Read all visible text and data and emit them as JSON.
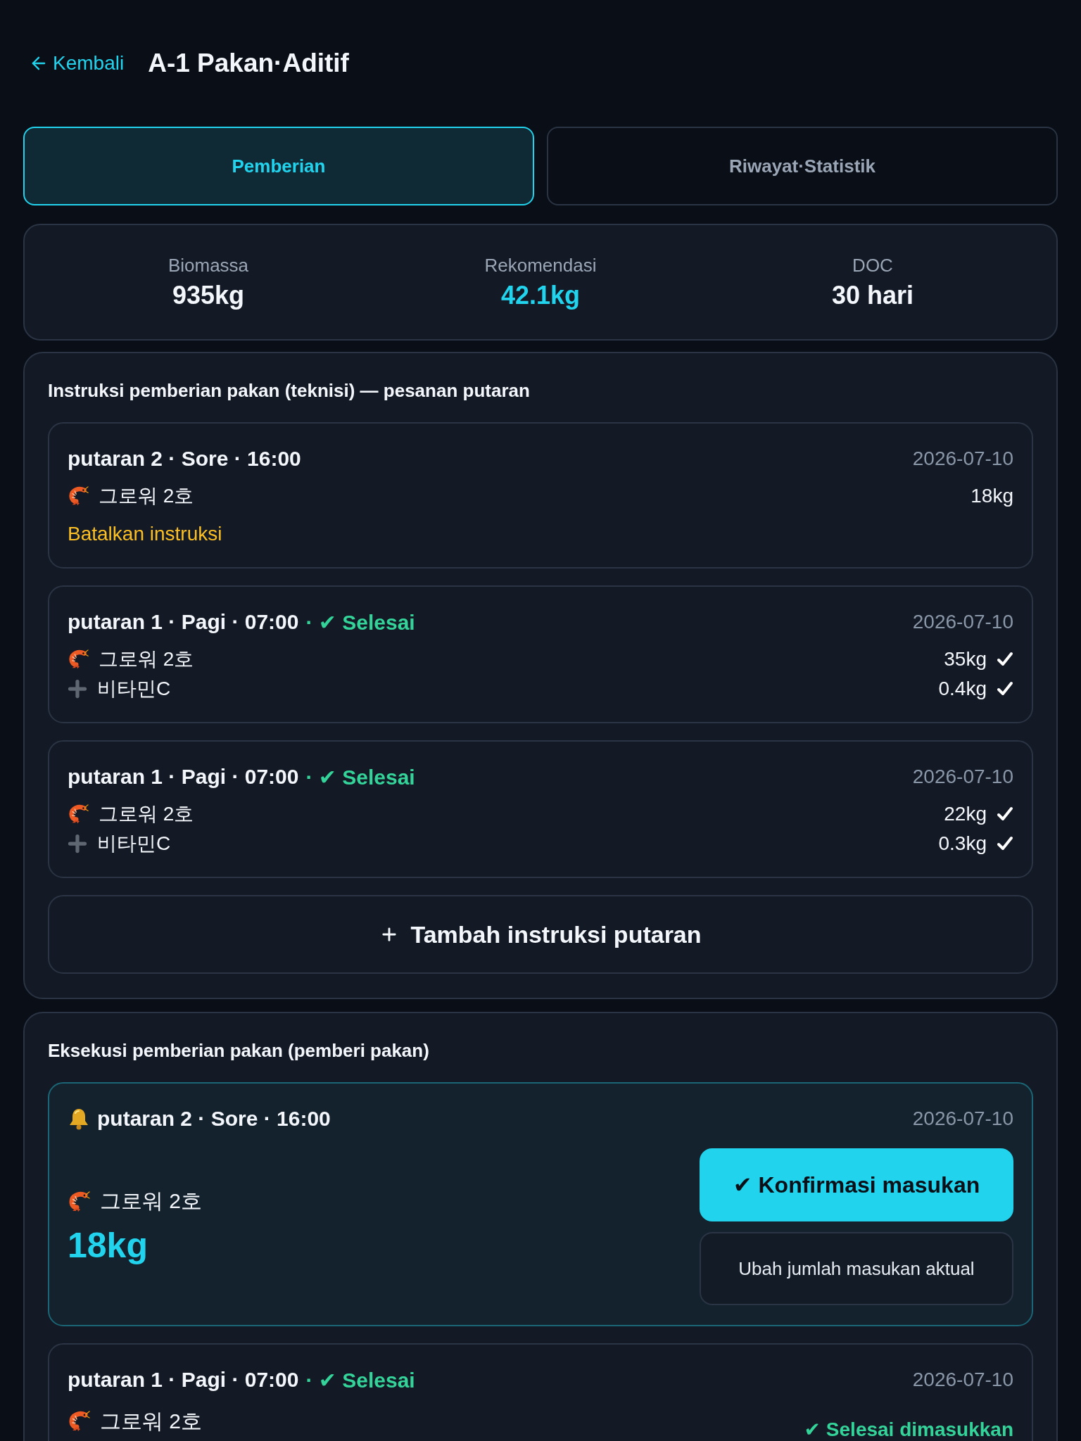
{
  "header": {
    "back_label": "Kembali",
    "title": "A-1 Pakan·Aditif"
  },
  "tabs": [
    {
      "label": "Pemberian",
      "selected": true
    },
    {
      "label": "Riwayat·Statistik",
      "selected": false
    }
  ],
  "stats": [
    {
      "label": "Biomassa",
      "value": "935kg",
      "highlight": false
    },
    {
      "label": "Rekomendasi",
      "value": "42.1kg",
      "highlight": true
    },
    {
      "label": "DOC",
      "value": "30 hari",
      "highlight": false
    }
  ],
  "instructions": {
    "title": "Instruksi pemberian pakan (teknisi) — pesanan putaran",
    "rounds": [
      {
        "title": "putaran 2 · Sore · 16:00",
        "date": "2026-07-10",
        "items": [
          {
            "kind": "feed",
            "name": "그로워 2호",
            "amount": "18kg",
            "confirmed": false
          }
        ],
        "cancel_link": "Batalkan instruksi"
      },
      {
        "title": "putaran 1 · Pagi · 07:00",
        "status": "· ✔ Selesai",
        "date": "2026-07-10",
        "items": [
          {
            "kind": "feed",
            "name": "그로워 2호",
            "amount": "35kg",
            "confirmed": true
          },
          {
            "kind": "additive",
            "name": "비타민C",
            "amount": "0.4kg",
            "confirmed": true
          }
        ]
      },
      {
        "title": "putaran 1 · Pagi · 07:00",
        "status": "· ✔ Selesai",
        "date": "2026-07-10",
        "items": [
          {
            "kind": "feed",
            "name": "그로워 2호",
            "amount": "22kg",
            "confirmed": true
          },
          {
            "kind": "additive",
            "name": "비타민C",
            "amount": "0.3kg",
            "confirmed": true
          }
        ]
      }
    ],
    "add_button": "Tambah instruksi putaran"
  },
  "execution": {
    "title": "Eksekusi pemberian pakan (pemberi pakan)",
    "rounds": [
      {
        "kind": "pending",
        "title": "putaran 2 · Sore · 16:00",
        "date": "2026-07-10",
        "items": [
          {
            "kind": "feed",
            "name": "그로워 2호",
            "amount": "18kg"
          }
        ],
        "confirm_button": "✔ Konfirmasi masukan",
        "edit_button": "Ubah jumlah masukan aktual"
      },
      {
        "kind": "done",
        "title": "putaran 1 · Pagi · 07:00",
        "status": "· ✔ Selesai",
        "date": "2026-07-10",
        "items": [
          {
            "kind": "feed",
            "name": "그로워 2호"
          }
        ],
        "result": "✔ Selesai dimasukkan"
      }
    ]
  }
}
